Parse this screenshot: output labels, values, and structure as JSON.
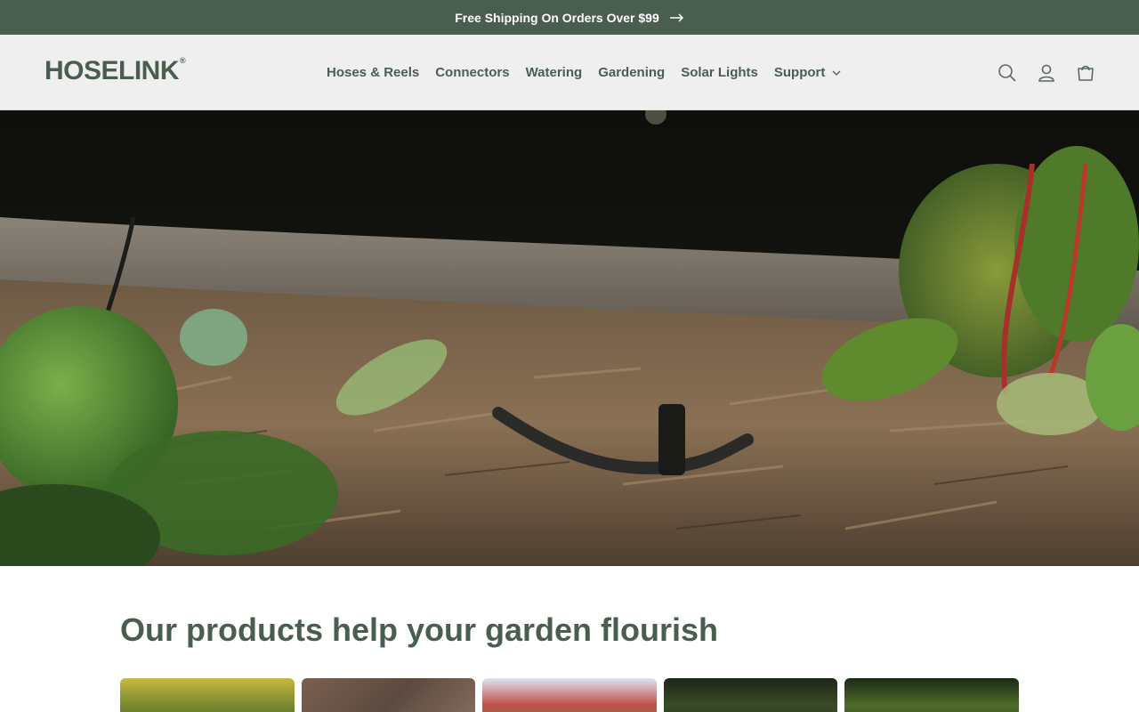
{
  "announcement": {
    "text": "Free Shipping On Orders Over $99",
    "arrow_icon": "arrow-right-icon"
  },
  "header": {
    "logo_text": "HOSELINK",
    "logo_mark": "®",
    "nav": [
      {
        "label": "Hoses & Reels"
      },
      {
        "label": "Connectors"
      },
      {
        "label": "Watering"
      },
      {
        "label": "Gardening"
      },
      {
        "label": "Solar Lights"
      },
      {
        "label": "Support",
        "dropdown_icon": "chevron-down-icon"
      }
    ],
    "icons": [
      "search-icon",
      "account-icon",
      "cart-icon"
    ]
  },
  "hero": {
    "image": "garden bed with mulch, leafy greens and drip irrigation sprayer"
  },
  "products_section": {
    "title": "Our products help your garden flourish",
    "card_count": 5
  },
  "colors": {
    "brand_green": "#4a5e50",
    "header_bg": "#efefef",
    "page_bg": "#ffffff"
  }
}
